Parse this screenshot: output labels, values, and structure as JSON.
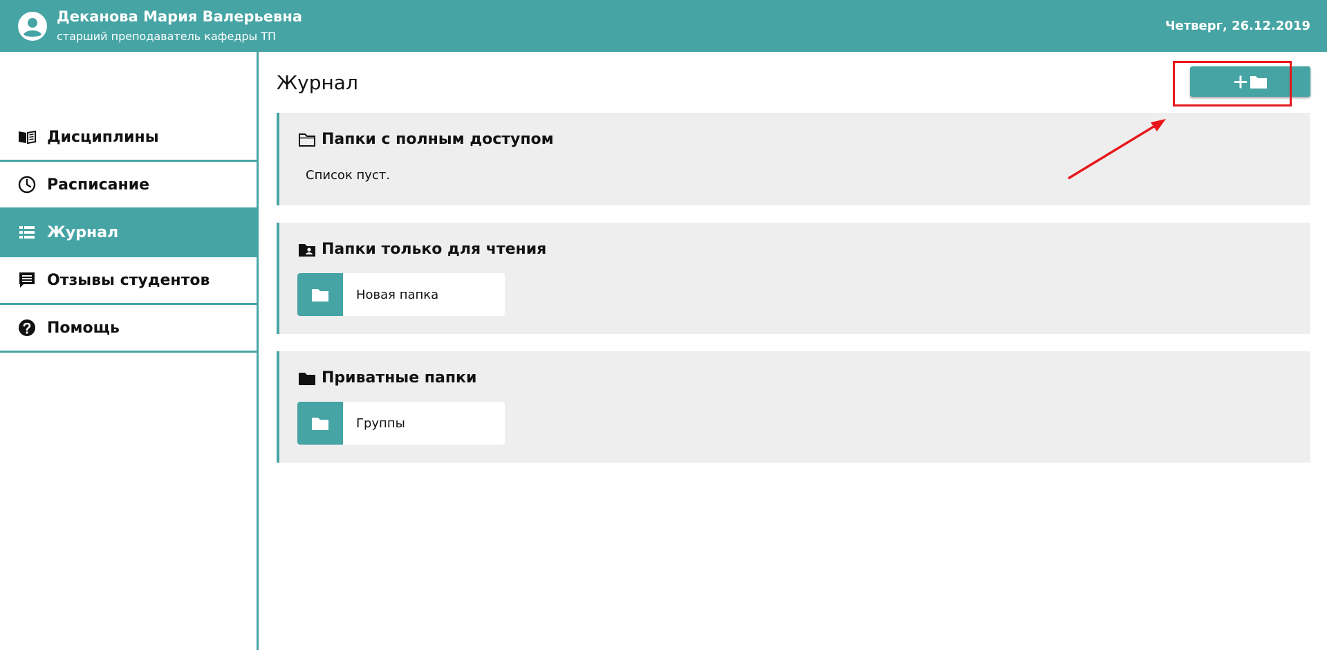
{
  "header": {
    "user_name": "Деканова Мария Валерьевна",
    "user_role": "старший преподаватель кафедры ТП",
    "date": "Четверг, 26.12.2019",
    "avatar_icon": "user-circle-icon",
    "background": "#46a4a4"
  },
  "sidebar": {
    "items": [
      {
        "label": "Дисциплины",
        "icon": "book-icon",
        "active": false
      },
      {
        "label": "Расписание",
        "icon": "clock-icon",
        "active": false
      },
      {
        "label": "Журнал",
        "icon": "list-icon",
        "active": true
      },
      {
        "label": "Отзывы студентов",
        "icon": "comment-icon",
        "active": false
      },
      {
        "label": "Помощь",
        "icon": "question-circle-icon",
        "active": false
      }
    ]
  },
  "main": {
    "title": "Журнал",
    "add_folder_button": {
      "icons": [
        "plus-icon",
        "folder-icon"
      ]
    },
    "sections": [
      {
        "title": "Папки с полным доступом",
        "icon": "folder-outline-icon",
        "empty_text": "Список пуст.",
        "folders": []
      },
      {
        "title": "Папки только для чтения",
        "icon": "folder-user-icon",
        "folders": [
          {
            "label": "Новая папка",
            "icon": "folder-icon"
          }
        ]
      },
      {
        "title": "Приватные папки",
        "icon": "folder-icon",
        "folders": [
          {
            "label": "Группы",
            "icon": "folder-icon"
          }
        ]
      }
    ]
  },
  "colors": {
    "accent": "#46a4a4",
    "section_background": "#eeeeee",
    "annotation": "#e8161b"
  }
}
